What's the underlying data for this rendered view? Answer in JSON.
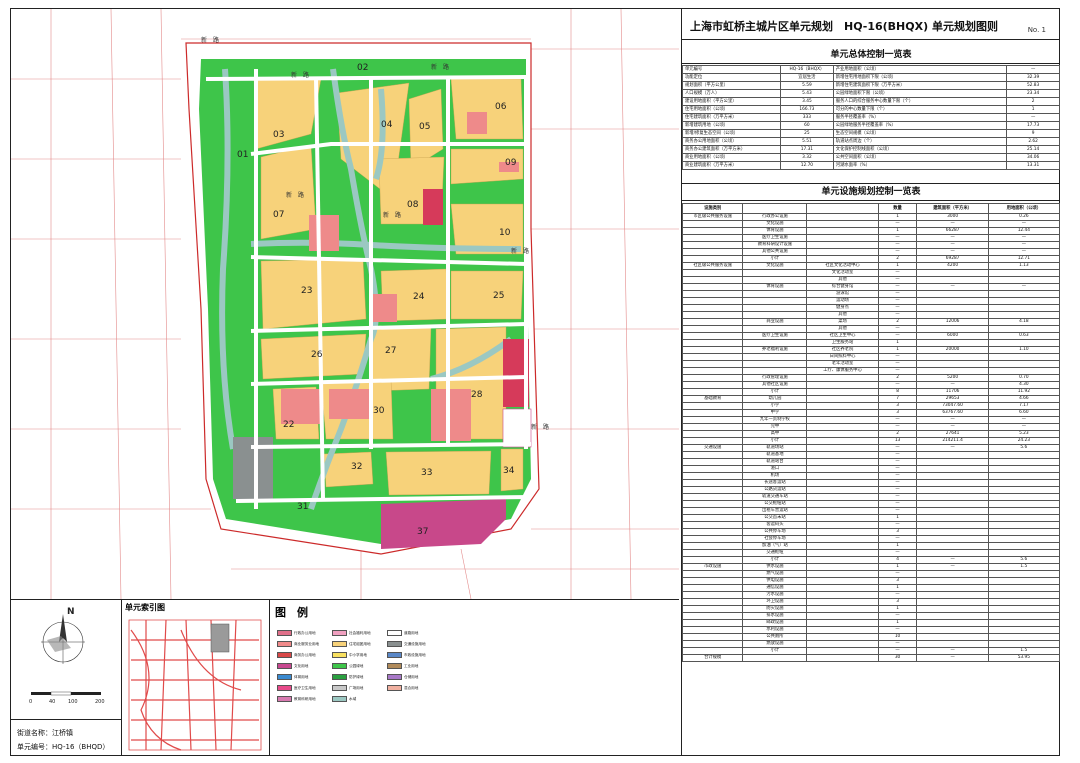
{
  "title": {
    "text": "上海市虹桥主城片区单元规划　HQ-16(BHQX) 单元规划图则",
    "no": "No. 1"
  },
  "overall_table": {
    "heading": "单元总体控制一览表",
    "rows": [
      [
        "单元编号",
        "HQ-16（BHQX）",
        "产业用地面积（公顷）",
        "—"
      ],
      [
        "功能定位",
        "宜居生活",
        "新增住宅用地面积下限（公顷）",
        "32.39"
      ],
      [
        "规划面积（平方公里）",
        "5.59",
        "新增住宅建筑面积下限（万平方米）",
        "52.83"
      ],
      [
        "人口规模（万人）",
        "5.43",
        "公园绿地面积下限（公顷）",
        "23.34"
      ],
      [
        "建设用地面积（平方公里）",
        "3.45",
        "服务人口的综合服务中心数量下限（个）",
        "2"
      ],
      [
        "住宅用地面积（公顷）",
        "166.73",
        "可分的中心数量下限（个）",
        "1"
      ],
      [
        "住宅建筑面积（万平方米）",
        "333",
        "服务半径覆盖率（%）",
        "—"
      ],
      [
        "新增建筑用地（公顷）",
        "60",
        "公园绿地服务半径覆盖率（%）",
        "17.73"
      ],
      [
        "新增/修复生态空间（公顷）",
        "25",
        "生态空间规模（公顷）",
        "9"
      ],
      [
        "商务办公用地面积（公顷）",
        "5.51",
        "轨道站点周边（个）",
        "2.62"
      ],
      [
        "商务办公建筑面积（万平方米）",
        "17.31",
        "文化保护控制线面积（公顷）",
        "25.14"
      ],
      [
        "商业用地面积（公顷）",
        "3.32",
        "公共空间面积（公顷）",
        "34.06"
      ],
      [
        "商业建筑面积（万平方米）",
        "12.70",
        "河湖水面率（%）",
        "13.31"
      ]
    ]
  },
  "facility_table": {
    "heading": "单元设施规划控制一览表",
    "headers": [
      "设施类别",
      "",
      "",
      "数量",
      "建筑面积（平方米）",
      "用地面积（公顷）"
    ],
    "rows": [
      [
        "市区级公共服务设施",
        "行政办公设施",
        "",
        "1",
        "3000",
        "0.26"
      ],
      [
        "",
        "文化设施",
        "",
        "—",
        "—",
        "—"
      ],
      [
        "",
        "体育设施",
        "",
        "1",
        "66287",
        "12.44"
      ],
      [
        "",
        "医疗卫生设施",
        "",
        "—",
        "—",
        "—"
      ],
      [
        "",
        "教育科研设计设施",
        "",
        "—",
        "—",
        "—"
      ],
      [
        "",
        "其他公共设施",
        "",
        "—",
        "—",
        "—"
      ],
      [
        "",
        "小计",
        "",
        "2",
        "69287",
        "12.71"
      ],
      [
        "社区级公共服务设施",
        "文化设施",
        "社区文化活动中心",
        "1",
        "4200",
        "1.13"
      ],
      [
        "",
        "",
        "文化活动室",
        "—",
        "",
        ""
      ],
      [
        "",
        "",
        "其他",
        "—",
        "",
        ""
      ],
      [
        "",
        "体育设施",
        "综合健身馆",
        "—",
        "—",
        "—"
      ],
      [
        "",
        "",
        "游泳馆",
        "—",
        "",
        ""
      ],
      [
        "",
        "",
        "运动场",
        "—",
        "",
        ""
      ],
      [
        "",
        "",
        "健身点",
        "—",
        "",
        ""
      ],
      [
        "",
        "",
        "其他",
        "—",
        "",
        ""
      ],
      [
        "",
        "商业设施",
        "菜场",
        "2",
        "12006",
        "4.18"
      ],
      [
        "",
        "",
        "其他",
        "—",
        "",
        ""
      ],
      [
        "",
        "医疗卫生设施",
        "社区卫生中心",
        "—",
        "6000",
        "0.63"
      ],
      [
        "",
        "",
        "卫生服务站",
        "1",
        "",
        ""
      ],
      [
        "",
        "养老福利设施",
        "社区养老院",
        "1",
        "20000",
        "1.10"
      ],
      [
        "",
        "",
        "日间照料中心",
        "—",
        "",
        ""
      ],
      [
        "",
        "",
        "老年活动室",
        "—",
        "",
        ""
      ],
      [
        "",
        "",
        "工疗、康体服务中心",
        "—",
        "",
        ""
      ],
      [
        "",
        "行政管理设施",
        "",
        "2",
        "5200",
        "0.70"
      ],
      [
        "",
        "其他社区设施",
        "",
        "—",
        "—",
        "4.30"
      ],
      [
        "",
        "小计",
        "",
        "8",
        "11706",
        "11.92"
      ],
      [
        "基础教育",
        "幼儿园",
        "",
        "7",
        "29653",
        "4.66"
      ],
      [
        "",
        "小学",
        "",
        "3",
        "73047.60",
        "7.17"
      ],
      [
        "",
        "中学",
        "",
        "3",
        "63767.60",
        "6.60"
      ],
      [
        "",
        "九年一贯制学校",
        "",
        "—",
        "—",
        "—"
      ],
      [
        "",
        "完中",
        "",
        "—",
        "—",
        "—"
      ],
      [
        "",
        "高中",
        "",
        "2",
        "27641",
        "5.23"
      ],
      [
        "",
        "小计",
        "",
        "13",
        "214211.4",
        "24.23"
      ],
      [
        "交通设施",
        "轨道场站",
        "",
        "—",
        "—",
        "5.6"
      ],
      [
        "",
        "轨道基地",
        "",
        "—",
        "",
        ""
      ],
      [
        "",
        "轨道站台",
        "",
        "—",
        "",
        ""
      ],
      [
        "",
        "港口",
        "",
        "—",
        "",
        ""
      ],
      [
        "",
        "机场",
        "",
        "—",
        "",
        ""
      ],
      [
        "",
        "长途客运站",
        "",
        "—",
        "",
        ""
      ],
      [
        "",
        "公路货运站",
        "",
        "—",
        "",
        ""
      ],
      [
        "",
        "轨道交通车站",
        "",
        "—",
        "",
        ""
      ],
      [
        "",
        "公交枢纽站",
        "",
        "—",
        "",
        ""
      ],
      [
        "",
        "出租车营运站",
        "",
        "—",
        "",
        ""
      ],
      [
        "",
        "公交首末站",
        "",
        "1",
        "",
        ""
      ],
      [
        "",
        "客运码头",
        "",
        "—",
        "",
        ""
      ],
      [
        "",
        "公共停车场",
        "",
        "3",
        "",
        ""
      ],
      [
        "",
        "社会停车场",
        "",
        "—",
        "",
        ""
      ],
      [
        "",
        "加油（气）站",
        "",
        "1",
        "",
        ""
      ],
      [
        "",
        "交通枢纽",
        "",
        "—",
        "",
        ""
      ],
      [
        "",
        "小计",
        "",
        "4",
        "—",
        "5.6"
      ],
      [
        "市政设施",
        "供水设施",
        "",
        "1",
        "—",
        "1.5"
      ],
      [
        "",
        "燃气设施",
        "",
        "—",
        "",
        ""
      ],
      [
        "",
        "供电设施",
        "",
        "3",
        "",
        ""
      ],
      [
        "",
        "通信设施",
        "",
        "1",
        "",
        ""
      ],
      [
        "",
        "污水设施",
        "",
        "—",
        "",
        ""
      ],
      [
        "",
        "环卫设施",
        "",
        "3",
        "",
        ""
      ],
      [
        "",
        "防灾设施",
        "",
        "1",
        "",
        ""
      ],
      [
        "",
        "排水设施",
        "",
        "—",
        "",
        ""
      ],
      [
        "",
        "邮政设施",
        "",
        "1",
        "",
        ""
      ],
      [
        "",
        "水利设施",
        "",
        "—",
        "",
        ""
      ],
      [
        "",
        "公共厕所",
        "",
        "10",
        "",
        ""
      ],
      [
        "",
        "燃放设施",
        "",
        "—",
        "",
        ""
      ],
      [
        "",
        "小计",
        "",
        "—",
        "—",
        "1.5"
      ]
    ],
    "total": [
      "合计规模",
      "",
      "",
      "30",
      "—",
      "53.95"
    ]
  },
  "map": {
    "parcels": [
      "01",
      "02",
      "03",
      "04",
      "05",
      "06",
      "07",
      "08",
      "09",
      "10",
      "22",
      "23",
      "24",
      "25",
      "26",
      "27",
      "28",
      "30",
      "31",
      "32",
      "33",
      "34",
      "37"
    ]
  },
  "index_map": {
    "title": "单元索引图"
  },
  "compass": {
    "north": "N",
    "scale": [
      "0",
      "40",
      "100",
      "200"
    ]
  },
  "legend": {
    "title": "图　例",
    "items": [
      "行政办公用地",
      "商业服务业用地",
      "商务办公用地",
      "文化用地",
      "体育用地",
      "医疗卫生用地",
      "教育科研用地",
      "社会福利用地",
      "住宅组团用地",
      "中小学用地",
      "公园绿地",
      "防护绿地",
      "广场用地",
      "水域",
      "道路用地",
      "交通设施用地",
      "市政设施用地",
      "工业用地",
      "仓储用地",
      "混合用地"
    ]
  },
  "street": {
    "name_label": "街道名称：江桥镇",
    "code_label": "单元编号：HQ-16（BHQD）"
  },
  "colors": {
    "residential": "#f7d27a",
    "green": "#3ec54a",
    "water": "#9bc8c2",
    "commercial": "#ee8a8a",
    "commercial_dark": "#d63a5a",
    "magenta": "#c8488a",
    "gray": "#8a9090",
    "road": "#ffffff"
  }
}
